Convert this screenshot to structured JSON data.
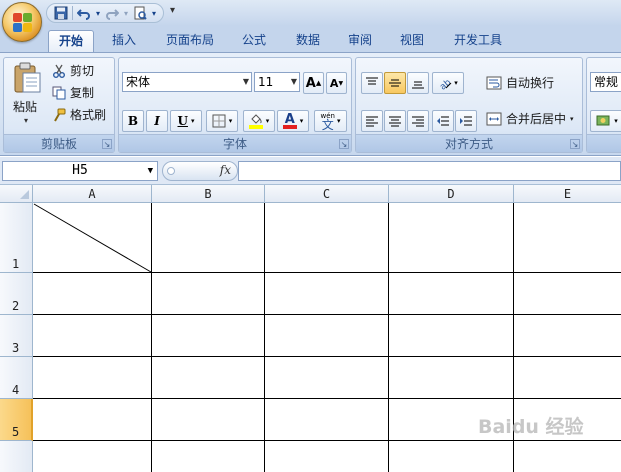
{
  "quick_access": {
    "more": "▾"
  },
  "tabs": [
    "开始",
    "插入",
    "页面布局",
    "公式",
    "数据",
    "审阅",
    "视图",
    "开发工具"
  ],
  "ribbon": {
    "clipboard": {
      "paste_label": "粘贴",
      "cut_label": "剪切",
      "copy_label": "复制",
      "format_painter_label": "格式刷",
      "group_label": "剪贴板"
    },
    "font": {
      "font_name": "宋体",
      "font_size": "11",
      "grow_label": "A",
      "shrink_label": "A",
      "bold": "B",
      "italic": "I",
      "underline": "U",
      "font_color_letter": "A",
      "phonetic_top": "wén",
      "phonetic_char": "文",
      "group_label": "字体"
    },
    "alignment": {
      "wrap_text_label": "自动换行",
      "merge_center_label": "合并后居中",
      "group_label": "对齐方式"
    },
    "number": {
      "format_value": "常规"
    }
  },
  "formula_bar": {
    "name_box": "H5",
    "fx_label": "fx",
    "formula": ""
  },
  "sheet": {
    "columns": [
      "A",
      "B",
      "C",
      "D",
      "E"
    ],
    "rows": [
      "1",
      "2",
      "3",
      "4",
      "5"
    ],
    "selected_row": "5",
    "accent_color": "#f6c15a",
    "diagonal_cell": "A1"
  },
  "watermark": "Baidu 经验"
}
